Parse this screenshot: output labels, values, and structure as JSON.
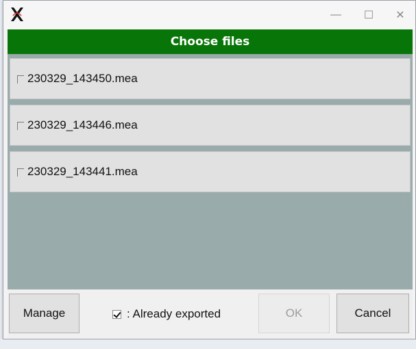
{
  "window": {
    "minimize_glyph": "—",
    "maximize_glyph": "☐",
    "close_glyph": "✕"
  },
  "header": {
    "title": "Choose files"
  },
  "files": [
    {
      "name": "230329_143450.mea",
      "checked": false
    },
    {
      "name": "230329_143446.mea",
      "checked": false
    },
    {
      "name": "230329_143441.mea",
      "checked": false
    }
  ],
  "footer": {
    "manage_label": "Manage",
    "legend_label": ": Already exported",
    "ok_label": "OK",
    "cancel_label": "Cancel"
  },
  "colors": {
    "header_bg": "#087508",
    "list_bg": "#9aabab"
  }
}
